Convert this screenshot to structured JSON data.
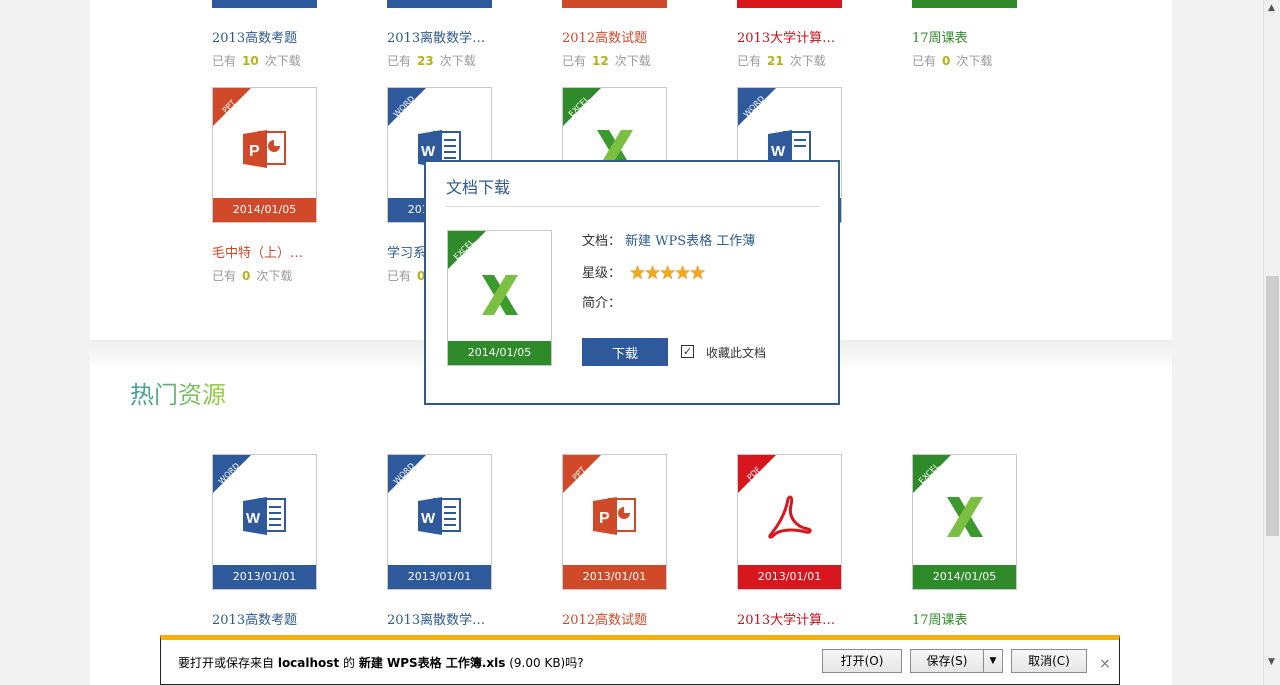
{
  "top_row": {
    "titles": [
      "2013高数考题",
      "2013离散数学…",
      "2012高数试题",
      "2013大学计算…",
      "17周课表"
    ],
    "title_colors": [
      "#2e5a8c",
      "#2e5a8c",
      "#d04a2a",
      "#c8101c",
      "#2f8a2a"
    ],
    "counts_prefix": "已有",
    "counts_suffix": "次下载",
    "counts": [
      "10",
      "23",
      "12",
      "21",
      "0"
    ]
  },
  "middle_row": [
    {
      "type_label": "PPT",
      "date": "2014/01/05",
      "title": "毛中特（上）…",
      "count": "0",
      "color": "#d04a2a",
      "icon": "ppt-icon"
    },
    {
      "type_label": "WORD",
      "date": "2014/01/05",
      "title": "学习系…",
      "count": "0",
      "color": "#2e5a9c",
      "icon": "word-icon"
    },
    {
      "type_label": "EXCEL",
      "date": "",
      "title": "",
      "count": "",
      "color": "#2f8a2a",
      "icon": "excel-icon"
    },
    {
      "type_label": "WORD",
      "date": "",
      "title": "",
      "count": "",
      "color": "#2e5a9c",
      "icon": "word-icon"
    }
  ],
  "section": {
    "title": "热门资源"
  },
  "hot_row": [
    {
      "type_label": "WORD",
      "date": "2013/01/01",
      "title": "2013高数考题",
      "color": "#2e5a9c",
      "title_color": "#2e5a8c",
      "icon": "word-icon"
    },
    {
      "type_label": "WORD",
      "date": "2013/01/01",
      "title": "2013离散数学…",
      "color": "#2e5a9c",
      "title_color": "#2e5a8c",
      "icon": "word-icon"
    },
    {
      "type_label": "PPT",
      "date": "2013/01/01",
      "title": "2012高数试题",
      "color": "#d04a2a",
      "title_color": "#d04a2a",
      "icon": "ppt-icon"
    },
    {
      "type_label": "PDF",
      "date": "2013/01/01",
      "title": "2013大学计算…",
      "color": "#d8161e",
      "title_color": "#c8101c",
      "icon": "pdf-icon"
    },
    {
      "type_label": "EXCEL",
      "date": "2014/01/05",
      "title": "17周课表",
      "color": "#2f8a2a",
      "title_color": "#2f8a2a",
      "icon": "excel-icon"
    }
  ],
  "dialog": {
    "title": "文档下载",
    "thumb_type": "EXCEL",
    "thumb_date": "2014/01/05",
    "doc_label": "文档：",
    "doc_name": "新建 WPS表格 工作薄",
    "rating_label": "星级：",
    "rating_stars": "★★★★★",
    "rating_value": 5,
    "intro_label": "简介：",
    "download_button": "下载",
    "favorite_checked": true,
    "favorite_label": "收藏此文档"
  },
  "download_bar": {
    "msg_prefix": "要打开或保存来自 ",
    "host": "localhost",
    "msg_mid": " 的 ",
    "filename": "新建 WPS表格 工作簿.xls",
    "size": " (9.00 KB)吗?",
    "open_button": "打开(O)",
    "save_button": "保存(S)",
    "save_dropdown": "▼",
    "cancel_button": "取消(C)",
    "close_glyph": "×"
  },
  "colors": {
    "accent_blue": "#2e5a8c",
    "excel_green": "#2f8a2a",
    "ppt_orange": "#d04a2a",
    "pdf_red": "#d8161e",
    "bar_yellow": "#f2b20b"
  }
}
